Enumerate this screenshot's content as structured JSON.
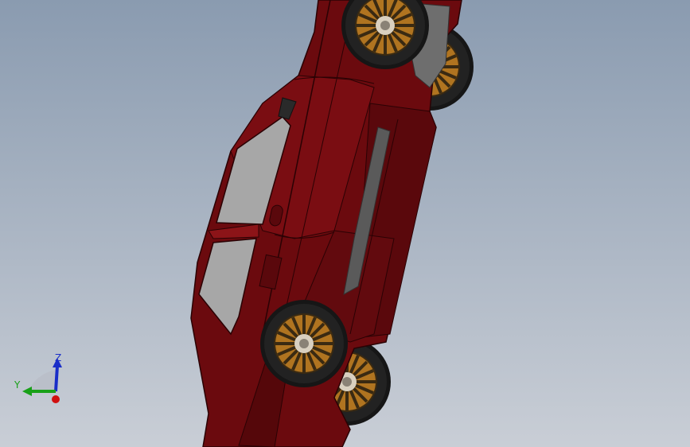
{
  "viewport": {
    "background_top": "#8a9bb0",
    "background_bottom": "#c9ced6"
  },
  "model": {
    "body_color": "#6b0a0e",
    "body_highlight": "#8c1418",
    "body_shadow": "#3d0508",
    "glass_color": "#a7a7a7",
    "tire_color": "#161616",
    "rim_color": "#b07420",
    "axle_color": "#b3b3b3"
  },
  "triad": {
    "x_label": "",
    "y_label": "Y",
    "z_label": "Z",
    "x_color": "#d01010",
    "y_color": "#18a018",
    "z_color": "#1a2ec8"
  }
}
